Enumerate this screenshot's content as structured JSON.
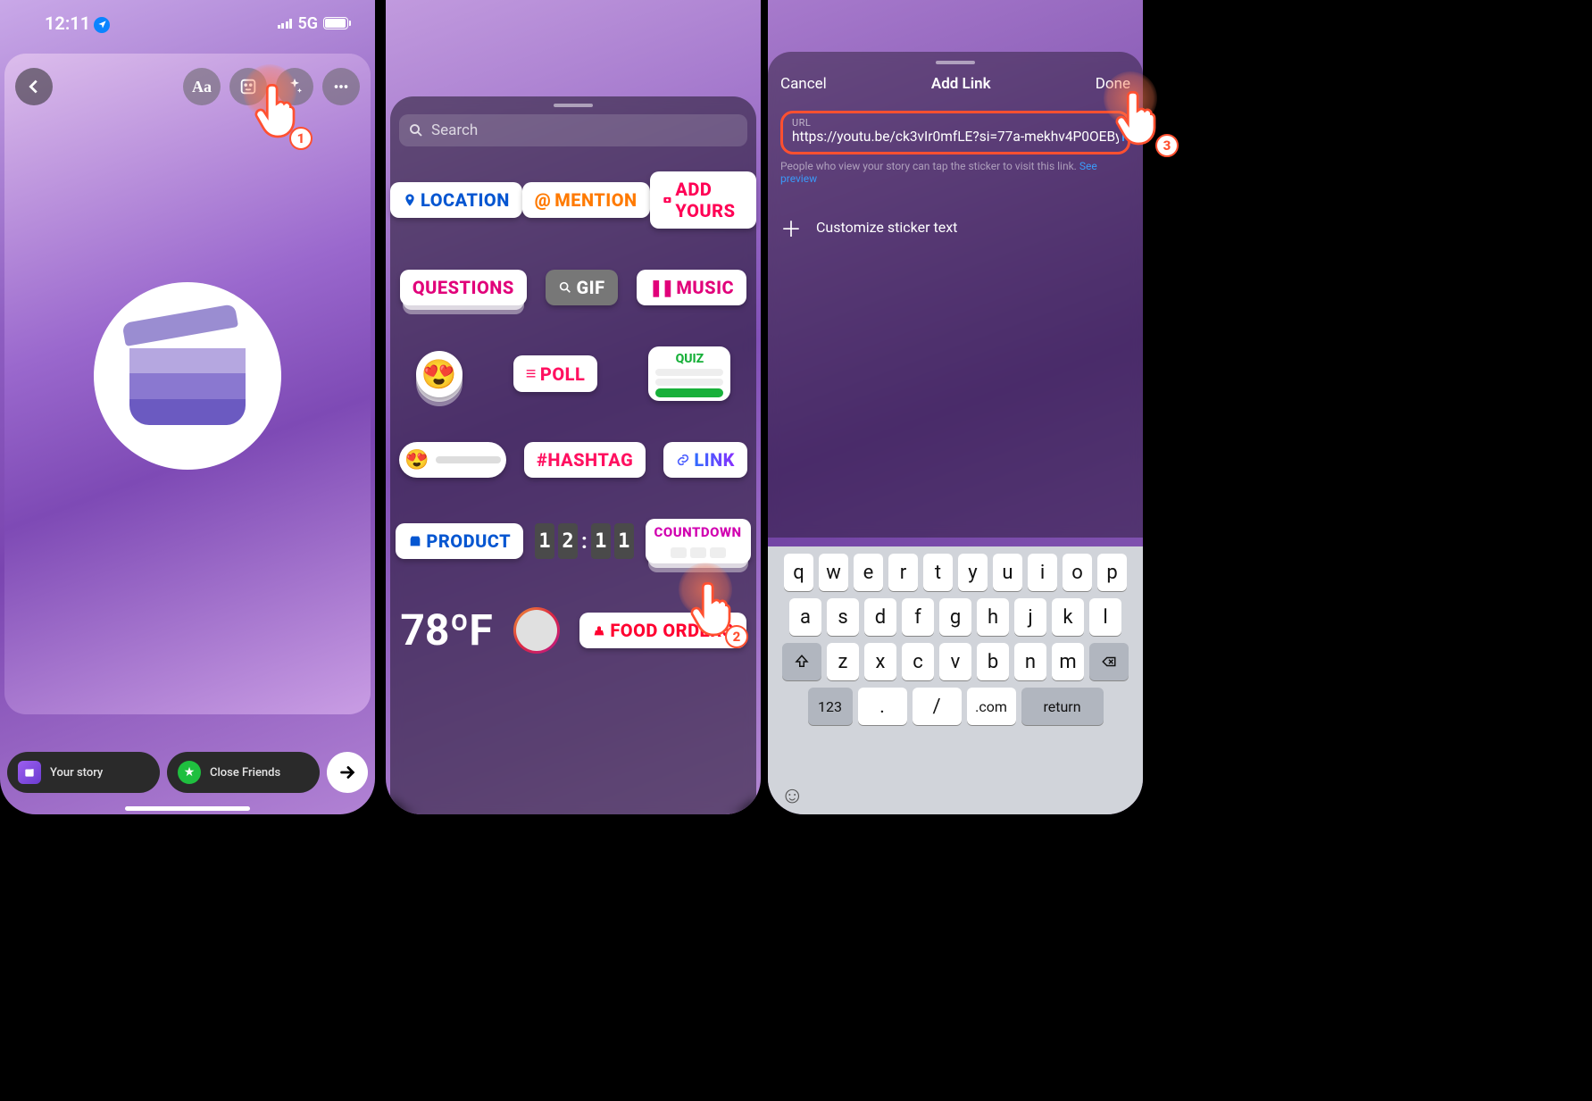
{
  "status_bar": {
    "time": "12:11",
    "network": "5G"
  },
  "screen1": {
    "toolbar": {
      "text_icon": "Aa"
    },
    "bottom": {
      "your_story": "Your story",
      "close_friends": "Close Friends"
    }
  },
  "screen2": {
    "search_placeholder": "Search",
    "stickers": {
      "location": "LOCATION",
      "mention": "MENTION",
      "add_yours": "ADD YOURS",
      "questions": "QUESTIONS",
      "gif": "GIF",
      "music": "MUSIC",
      "poll": "POLL",
      "quiz": "QUIZ",
      "hashtag": "#HASHTAG",
      "link": "LINK",
      "product": "PRODUCT",
      "countdown": "COUNTDOWN",
      "food_orders": "FOOD ORDERS",
      "weather": "78ºF",
      "time": {
        "d1": "1",
        "d2": "2",
        "d3": "1",
        "d4": "1"
      }
    }
  },
  "screen3": {
    "cancel": "Cancel",
    "title": "Add Link",
    "done": "Done",
    "url_label": "URL",
    "url_value": "https://youtu.be/ck3vIr0mfLE?si=77a-mekhv4P0OEBy",
    "help_text": "People who view your story can tap the sticker to visit this link.",
    "see_preview": "See preview",
    "customize": "Customize sticker text",
    "keyboard": {
      "row1": [
        "q",
        "w",
        "e",
        "r",
        "t",
        "y",
        "u",
        "i",
        "o",
        "p"
      ],
      "row2": [
        "a",
        "s",
        "d",
        "f",
        "g",
        "h",
        "j",
        "k",
        "l"
      ],
      "row3": [
        "z",
        "x",
        "c",
        "v",
        "b",
        "n",
        "m"
      ],
      "bottom": {
        "num": "123",
        "dot": ".",
        "slash": "/",
        "dotcom": ".com",
        "return": "return"
      }
    }
  },
  "annotations": {
    "step1": "1",
    "step2": "2",
    "step3": "3"
  }
}
